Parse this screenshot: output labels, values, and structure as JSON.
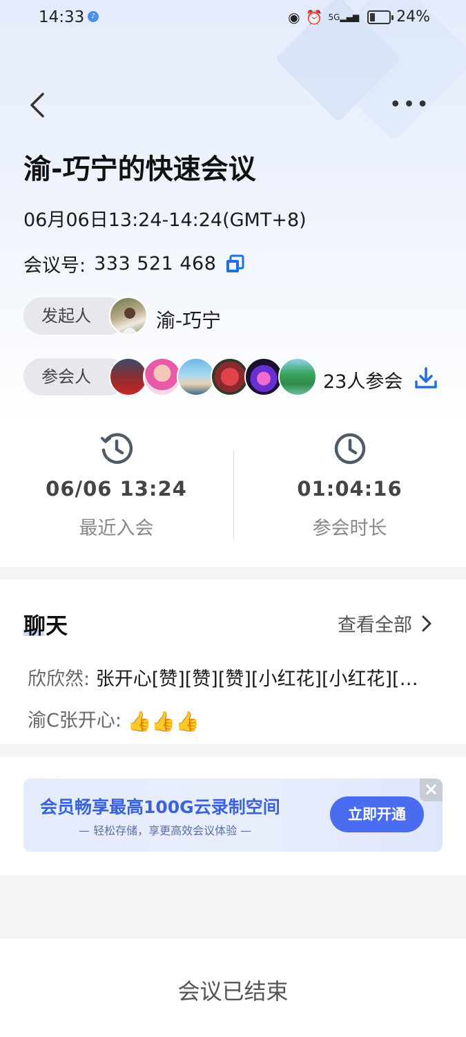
{
  "status_bar": {
    "time": "14:33",
    "signal_label": "5G",
    "battery_percent": "24%",
    "battery_level": 0.24
  },
  "header": {
    "more_label": "•••"
  },
  "meeting": {
    "title": "渝-巧宁的快速会议",
    "time_range": "06月06日13:24-14:24(GMT+8)",
    "id_label": "会议号:",
    "id_value": "333 521 468"
  },
  "host": {
    "label": "发起人",
    "name": "渝-巧宁"
  },
  "attendees": {
    "label": "参会人",
    "count_text": "23人参会",
    "avatars": [
      "attendee-1",
      "attendee-2",
      "attendee-3",
      "attendee-4",
      "attendee-5",
      "attendee-6"
    ]
  },
  "stats": {
    "last_join_value": "06/06 13:24",
    "last_join_label": "最近入会",
    "duration_value": "01:04:16",
    "duration_label": "参会时长"
  },
  "chat": {
    "title": "聊天",
    "view_all": "查看全部",
    "messages": [
      {
        "sender": "欣欣然:",
        "text": "张开心[赞][赞][赞][小红花][小红花][…"
      },
      {
        "sender": "渝C张开心:",
        "text": "👍👍👍"
      }
    ]
  },
  "promo": {
    "title": "会员畅享最高100G云录制空间",
    "subtitle": "— 轻松存储，享更高效会议体验 —",
    "button": "立即开通",
    "close": "×"
  },
  "footer": {
    "status": "会议已结束"
  },
  "colors": {
    "accent": "#1f6fe0",
    "promo_button": "#4a6cf0",
    "promo_text": "#3b63d9"
  }
}
